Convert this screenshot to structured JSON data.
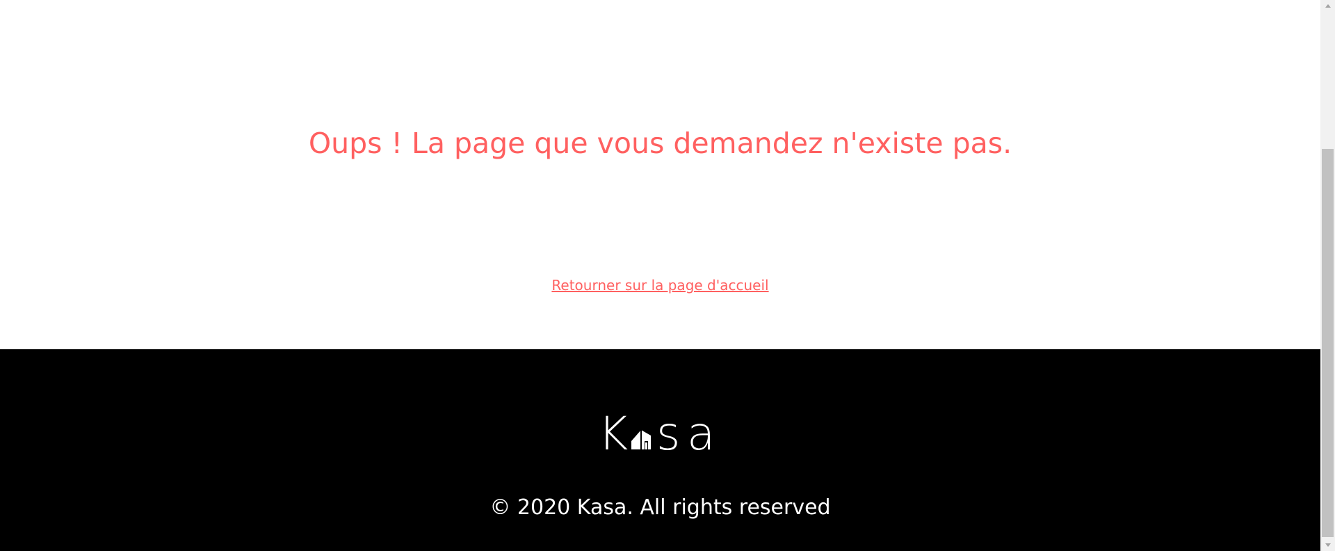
{
  "error": {
    "message": "Oups ! La page que vous demandez n'existe pas."
  },
  "navigation": {
    "home_link_label": "Retourner sur la page d'accueil"
  },
  "footer": {
    "logo": {
      "letters": [
        "K",
        "s",
        "a"
      ],
      "icon": "house-icon"
    },
    "copyright": "© 2020 Kasa. All rights reserved"
  },
  "colors": {
    "accent": "#FF6060",
    "footer_background": "#000000",
    "footer_text": "#FFFFFF",
    "page_background": "#FFFFFF",
    "scrollbar_track": "#F1F1F1",
    "scrollbar_thumb": "#C1C1C1"
  },
  "scrollbar": {
    "up_icon": "chevron-up-icon",
    "down_icon": "chevron-down-icon",
    "scroll_position": "bottom"
  }
}
